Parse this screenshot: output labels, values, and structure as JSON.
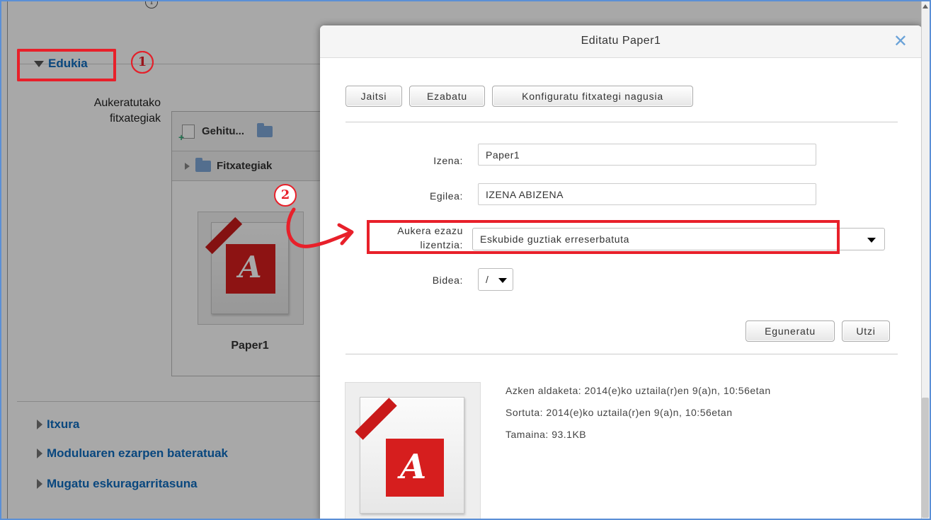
{
  "background": {
    "edukia_section": "Edukia",
    "field_label": "Aukeratutako fitxategiak",
    "field_label_line1": "Aukeratutako",
    "field_label_line2": "fitxategiak",
    "filemanager": {
      "add_label": "Gehitu...",
      "path_label": "Fitxategiak",
      "file_name": "Paper1"
    },
    "bottom_sections": [
      {
        "label": "Itxura"
      },
      {
        "label": "Moduluaren ezarpen bateratuak"
      },
      {
        "label": "Mugatu eskuragarritasuna"
      }
    ],
    "annotation_1": "1",
    "annotation_2": "2"
  },
  "modal": {
    "title": "Editatu Paper1",
    "close_icon": "close-icon",
    "toolbar": {
      "download_label": "Jaitsi",
      "delete_label": "Ezabatu",
      "set_main_label": "Konfiguratu fitxategi nagusia"
    },
    "form": {
      "name_label": "Izena:",
      "name_value": "Paper1",
      "author_label": "Egilea:",
      "author_value": "IZENA ABIZENA",
      "license_label_line1": "Aukera ezazu",
      "license_label_line2": "lizentzia:",
      "license_value": "Eskubide guztiak erreserbatuta",
      "path_label": "Bidea:",
      "path_value": "/"
    },
    "actions": {
      "update_label": "Eguneratu",
      "cancel_label": "Utzi"
    },
    "file_info": {
      "last_modified": "Azken aldaketa: 2014(e)ko uztaila(r)en 9(a)n, 10:56etan",
      "created": "Sortuta: 2014(e)ko uztaila(r)en 9(a)n, 10:56etan",
      "size": "Tamaina: 93.1KB"
    }
  },
  "colors": {
    "accent_blue": "#0f6cbf",
    "highlight_red": "#e8202a",
    "pdf_red": "#d61e1e"
  }
}
